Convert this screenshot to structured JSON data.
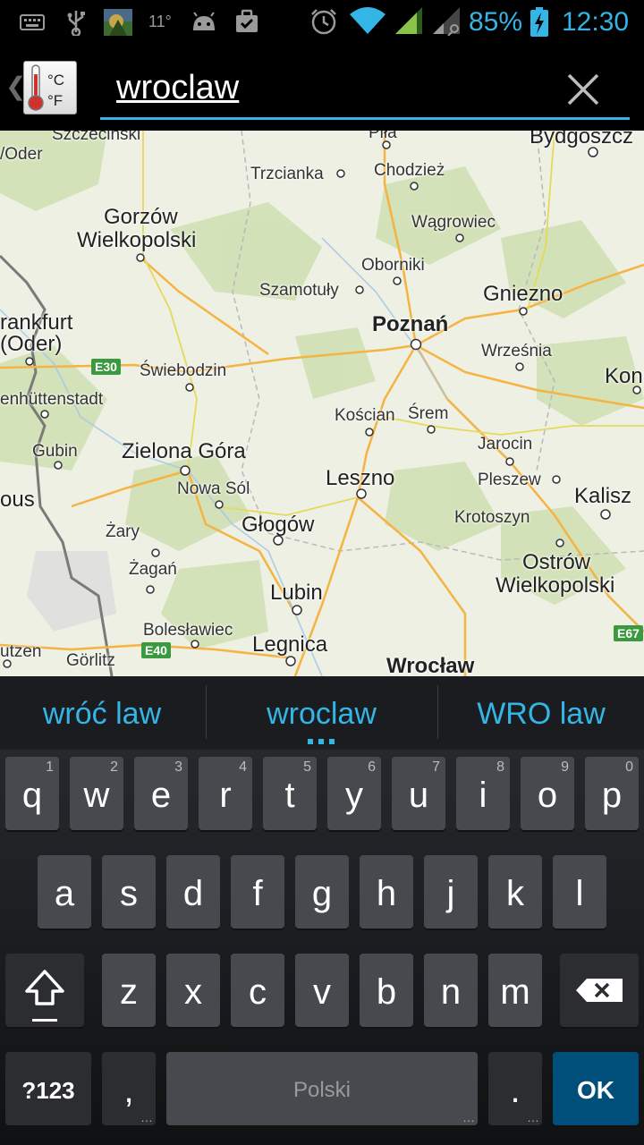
{
  "status_bar": {
    "temperature": "11°",
    "battery_percent": "85%",
    "time": "12:30",
    "icons": [
      "keyboard-icon",
      "usb-icon",
      "photo-thumbnail-icon",
      "android-icon",
      "briefcase-icon",
      "alarm-icon",
      "wifi-icon",
      "signal-icon",
      "signal-roaming-icon",
      "battery-charging-icon"
    ],
    "accent_color": "#33b5e5"
  },
  "action_bar": {
    "app_icon": "thermometer-celsius-fahrenheit-icon",
    "app_icon_text_c": "°C",
    "app_icon_text_f": "°F",
    "search_value": "wroclaw",
    "clear_icon": "close-icon"
  },
  "map": {
    "cities": [
      {
        "name": "Szczeciński"
      },
      {
        "name": "/Oder"
      },
      {
        "name": "Piła"
      },
      {
        "name": "Bydgoszcz"
      },
      {
        "name": "Trzcianka"
      },
      {
        "name": "Chodzież"
      },
      {
        "name": "Gorzów"
      },
      {
        "name": "Wielkopolski"
      },
      {
        "name": "Wągrowiec"
      },
      {
        "name": "Oborniki"
      },
      {
        "name": "Szamotuły"
      },
      {
        "name": "Gniezno"
      },
      {
        "name": "rankfurt"
      },
      {
        "name": "(Oder)"
      },
      {
        "name": "Poznań"
      },
      {
        "name": "Września"
      },
      {
        "name": "Świebodzin"
      },
      {
        "name": "Kon"
      },
      {
        "name": "enhüttenstadt"
      },
      {
        "name": "Kościan"
      },
      {
        "name": "Śrem"
      },
      {
        "name": "Gubin"
      },
      {
        "name": "Zielona Góra"
      },
      {
        "name": "Jarocin"
      },
      {
        "name": "Nowa Sól"
      },
      {
        "name": "Leszno"
      },
      {
        "name": "Pleszew"
      },
      {
        "name": "ous"
      },
      {
        "name": "Kalisz"
      },
      {
        "name": "Żary"
      },
      {
        "name": "Głogów"
      },
      {
        "name": "Krotoszyn"
      },
      {
        "name": "Żagań"
      },
      {
        "name": "Ostrów"
      },
      {
        "name": "Wielkopolski"
      },
      {
        "name": "Lubin"
      },
      {
        "name": "Bolesławiec"
      },
      {
        "name": "Legnica"
      },
      {
        "name": "utzen"
      },
      {
        "name": "Görlitz"
      },
      {
        "name": "Wrocław"
      }
    ],
    "road_badges": [
      "E30",
      "E40",
      "E67"
    ]
  },
  "suggestions": [
    "wróć law",
    "wroclaw",
    "WRO law"
  ],
  "keyboard": {
    "row1": [
      {
        "label": "q",
        "hint": "1"
      },
      {
        "label": "w",
        "hint": "2"
      },
      {
        "label": "e",
        "hint": "3"
      },
      {
        "label": "r",
        "hint": "4"
      },
      {
        "label": "t",
        "hint": "5"
      },
      {
        "label": "y",
        "hint": "6"
      },
      {
        "label": "u",
        "hint": "7"
      },
      {
        "label": "i",
        "hint": "8"
      },
      {
        "label": "o",
        "hint": "9"
      },
      {
        "label": "p",
        "hint": "0"
      }
    ],
    "row2": [
      "a",
      "s",
      "d",
      "f",
      "g",
      "h",
      "j",
      "k",
      "l"
    ],
    "row3": [
      "z",
      "x",
      "c",
      "v",
      "b",
      "n",
      "m"
    ],
    "symbols_label": "?123",
    "comma_label": ",",
    "space_label": "Polski",
    "period_label": ".",
    "ok_label": "OK",
    "shift_icon": "shift-icon",
    "backspace_icon": "backspace-icon"
  }
}
